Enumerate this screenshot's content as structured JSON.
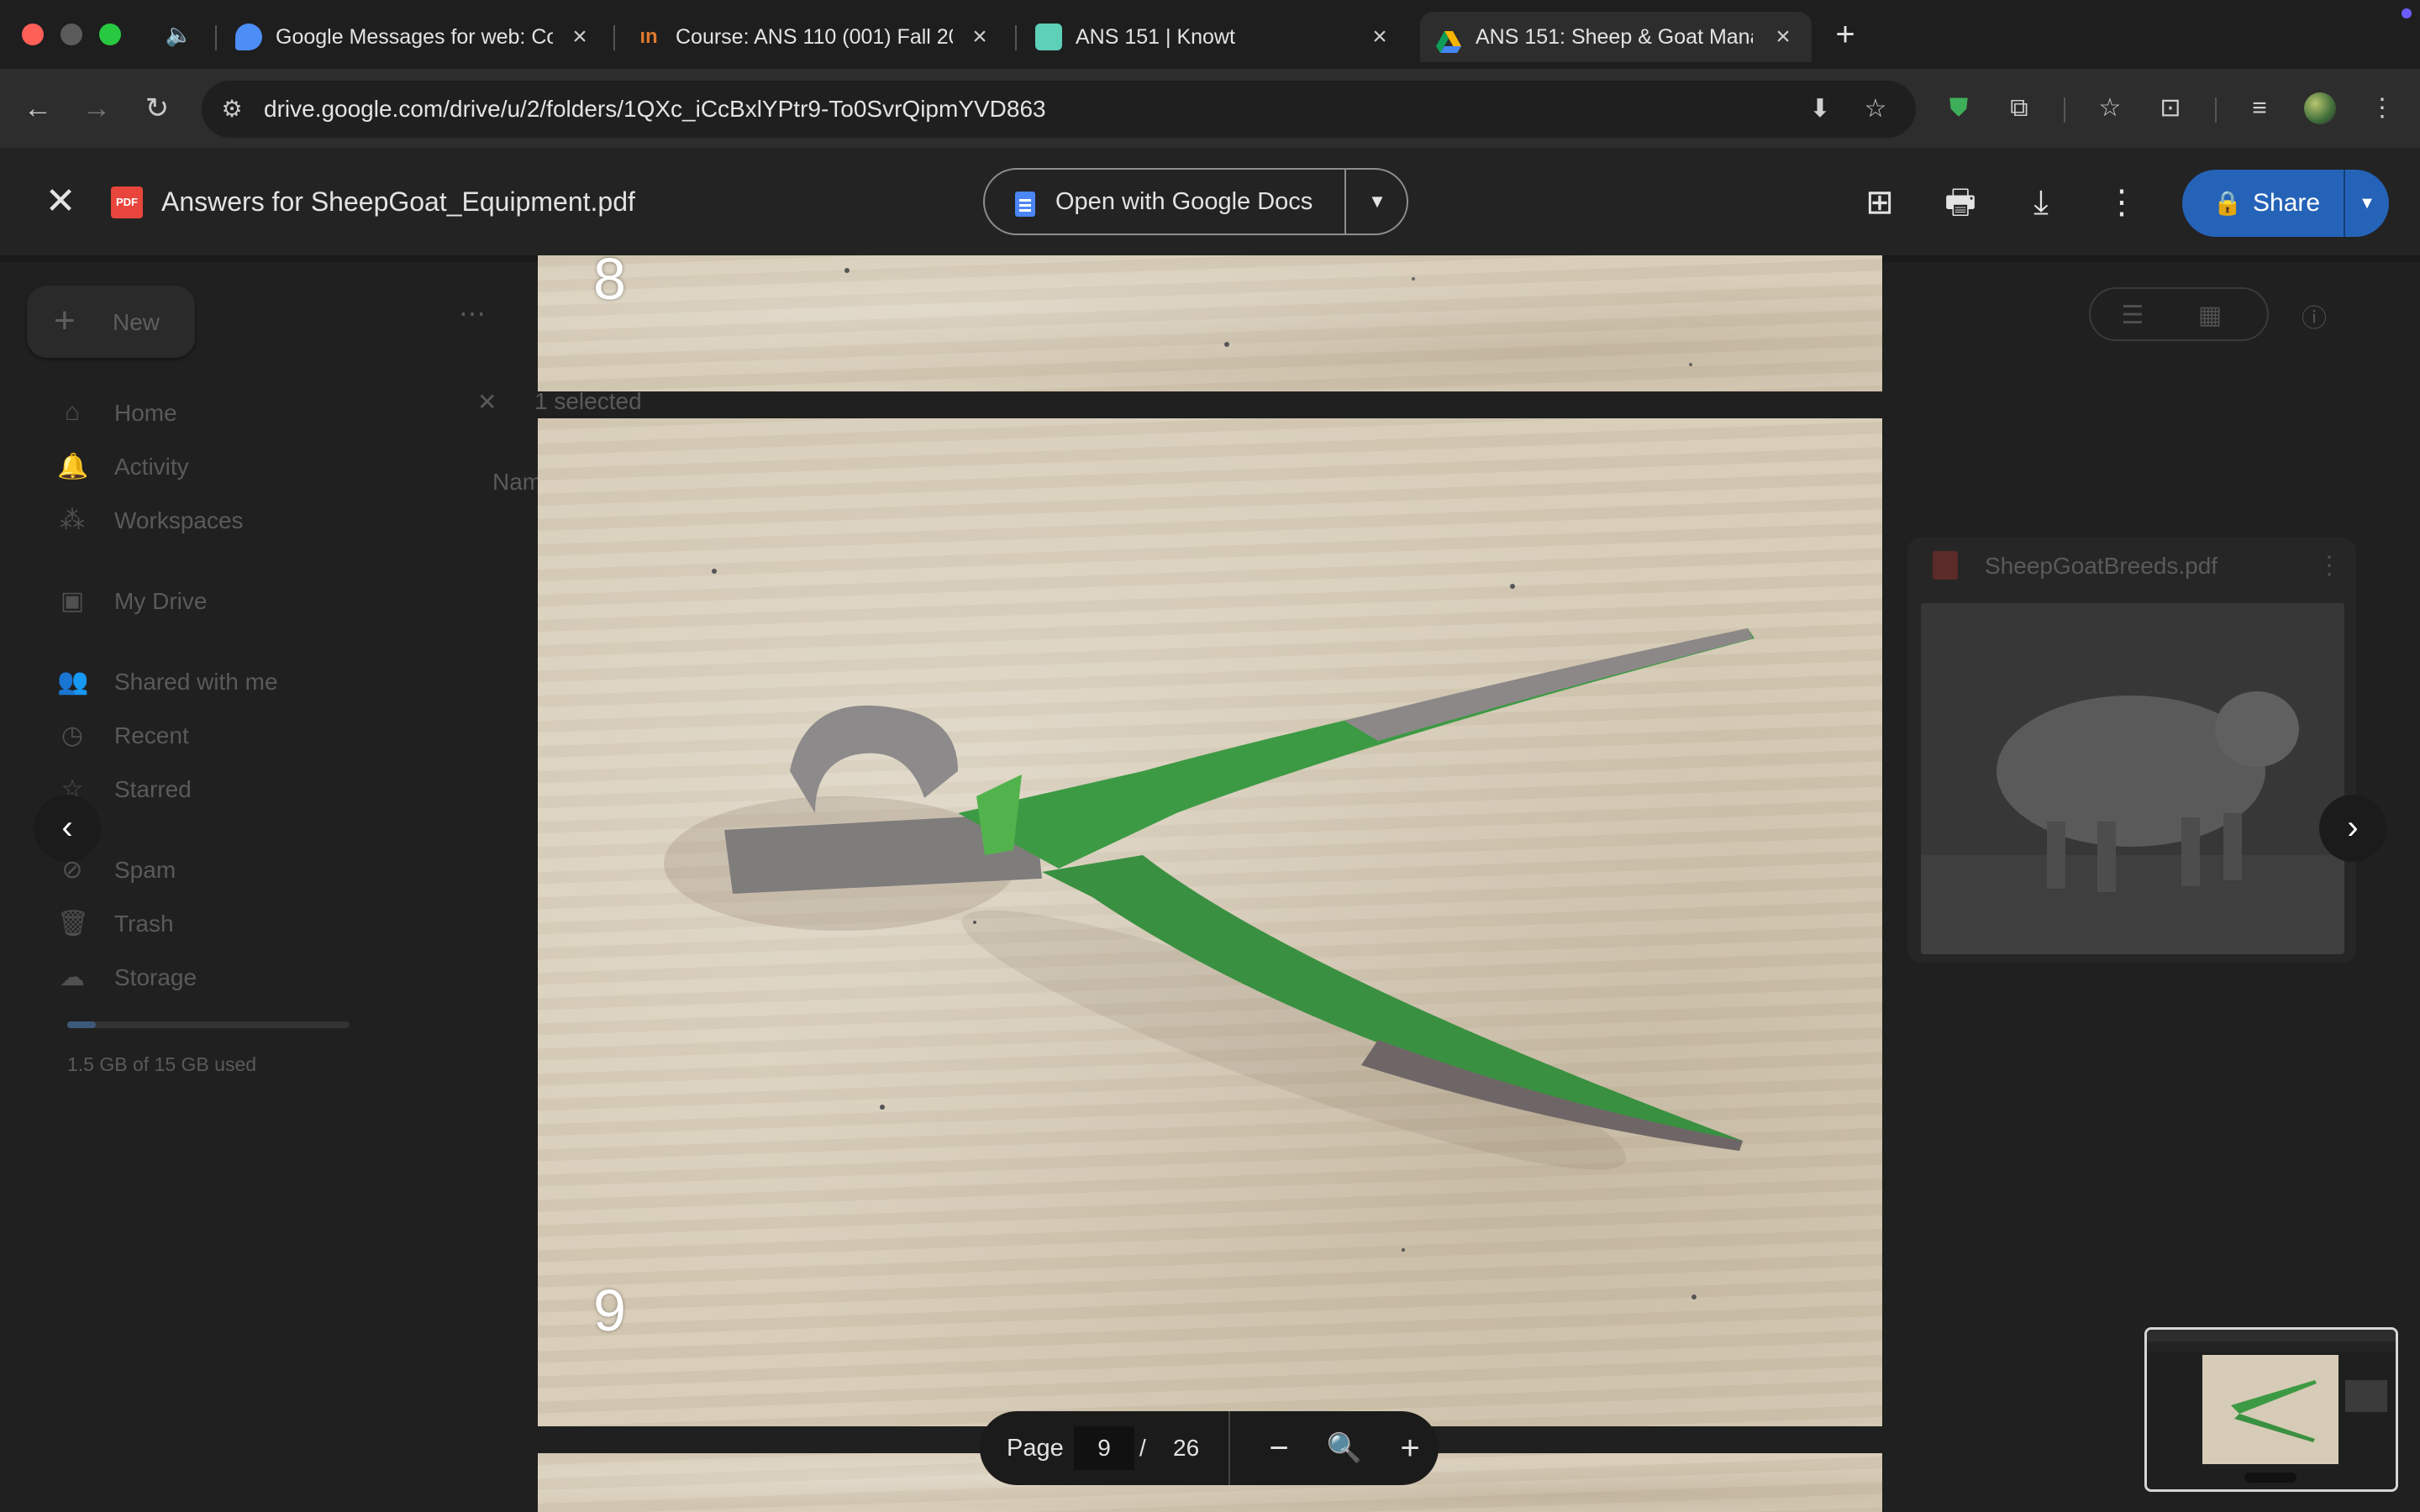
{
  "browser": {
    "tabs": [
      {
        "title": "Google Messages for web: Co",
        "favicon": "google-messages-icon",
        "color": "#4c8df6"
      },
      {
        "title": "Course: ANS 110 (001) Fall 20",
        "favicon": "canvas-icon",
        "color": "#e07a2e"
      },
      {
        "title": "ANS 151 | Knowt",
        "favicon": "knowt-icon",
        "color": "#5fd0b8"
      },
      {
        "title": "ANS 151: Sheep & Goat Mana",
        "favicon": "google-drive-icon",
        "color": "#f4b400",
        "active": true
      }
    ],
    "url": "drive.google.com/drive/u/2/folders/1QXc_iCcBxlYPtr9-To0SvrQipmYVD863"
  },
  "viewer": {
    "file_name": "Answers for SheepGoat_Equipment.pdf",
    "open_with_label": "Open with Google Docs",
    "share_label": "Share",
    "pages": [
      {
        "number": "8"
      },
      {
        "number": "9"
      }
    ],
    "pager": {
      "label": "Page",
      "current": "9",
      "separator": "/",
      "total": "26"
    }
  },
  "drive_background": {
    "new_label": "New",
    "selected_label": "1 selected",
    "name_header": "Nam",
    "nav": [
      "Home",
      "Activity",
      "Workspaces",
      "My Drive",
      "Shared with me",
      "Recent",
      "Starred",
      "Spam",
      "Trash",
      "Storage"
    ],
    "storage_text": "1.5 GB of 15 GB used",
    "storage_fraction": 0.1,
    "file_card_name": "SheepGoatBreeds.pdf"
  }
}
